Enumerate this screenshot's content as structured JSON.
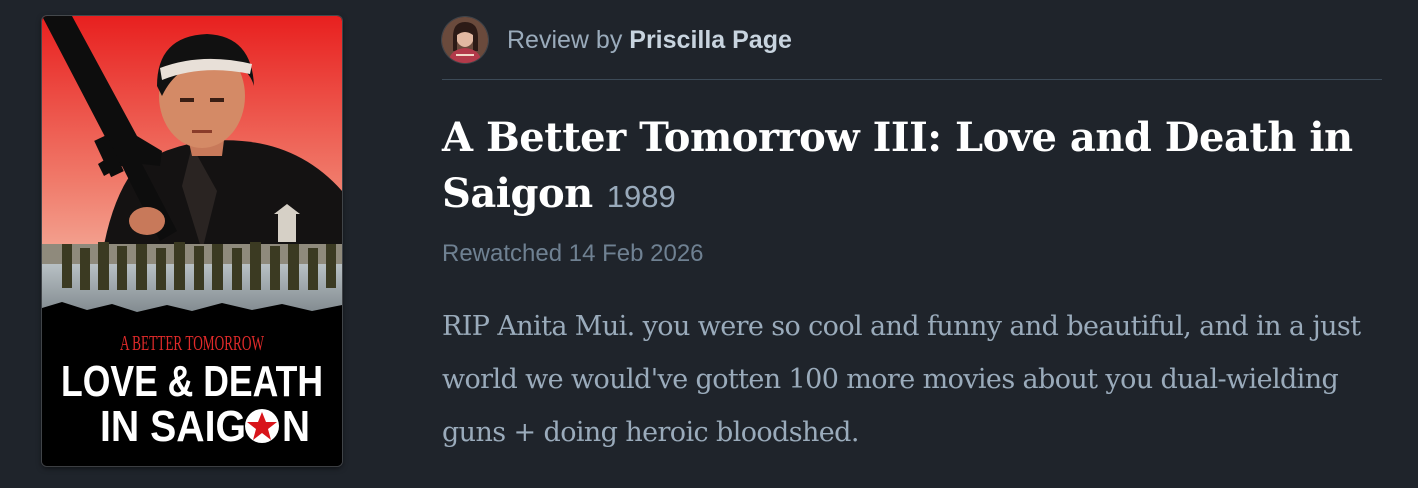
{
  "poster": {
    "tagline": "A BETTER TOMORROW",
    "line1": "LOVE & DEATH",
    "line2_part1": "IN SAIG",
    "line2_part2": "N"
  },
  "reviewer": {
    "prefix": "Review by",
    "name": "Priscilla Page"
  },
  "film": {
    "title": "A Better Tomorrow III: Love and Death in Saigon",
    "year": "1989"
  },
  "activity": {
    "label": "Rewatched 14 Feb 2026"
  },
  "review": {
    "text": "RIP Anita Mui. you were so cool and funny and beautiful, and in a just world we would've gotten 100 more movies about you dual-wielding guns + doing heroic bloodshed."
  },
  "colors": {
    "background": "#1f242b",
    "title": "#ffffff",
    "body": "#9aabbb",
    "muted": "#6f8192",
    "poster_red": "#e02a2a"
  }
}
